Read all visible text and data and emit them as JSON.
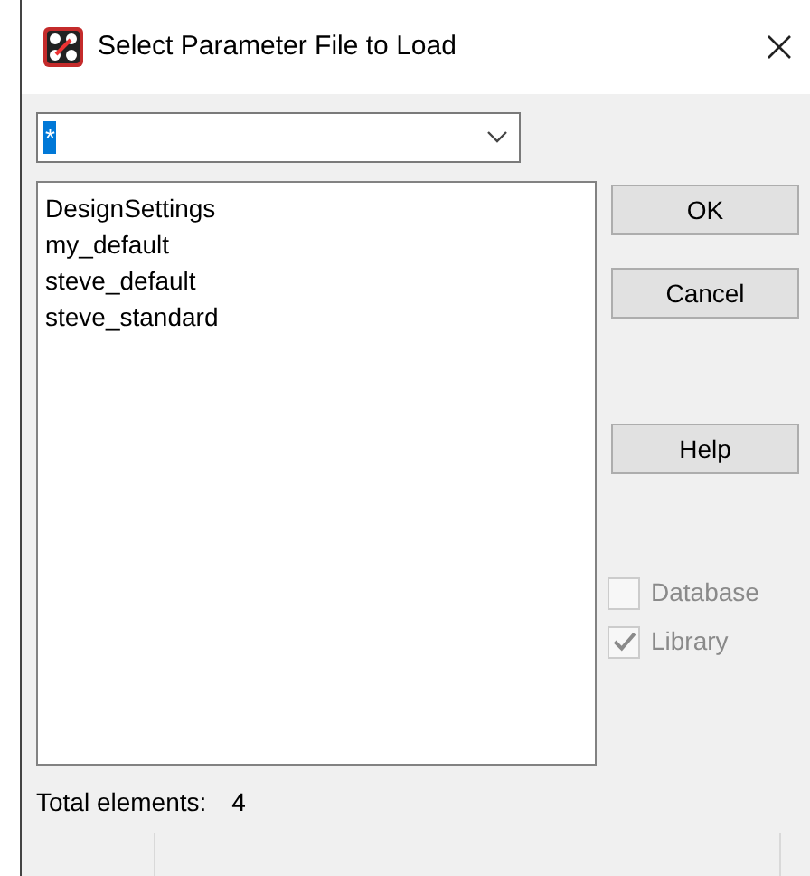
{
  "window": {
    "title": "Select Parameter File to Load"
  },
  "filter": {
    "value": "*",
    "selected": true
  },
  "files": [
    {
      "name": "DesignSettings",
      "selected": false
    },
    {
      "name": "my_default",
      "selected": false
    },
    {
      "name": "steve_default",
      "selected": false
    },
    {
      "name": "steve_standard",
      "selected": false
    }
  ],
  "buttons": [
    "OK",
    "Cancel",
    "Help"
  ],
  "options": [
    {
      "label": "Database",
      "checked": false,
      "disabled": true
    },
    {
      "label": "Library",
      "checked": true,
      "disabled": true
    }
  ],
  "total": {
    "label": "Total elements:",
    "value": "4"
  }
}
